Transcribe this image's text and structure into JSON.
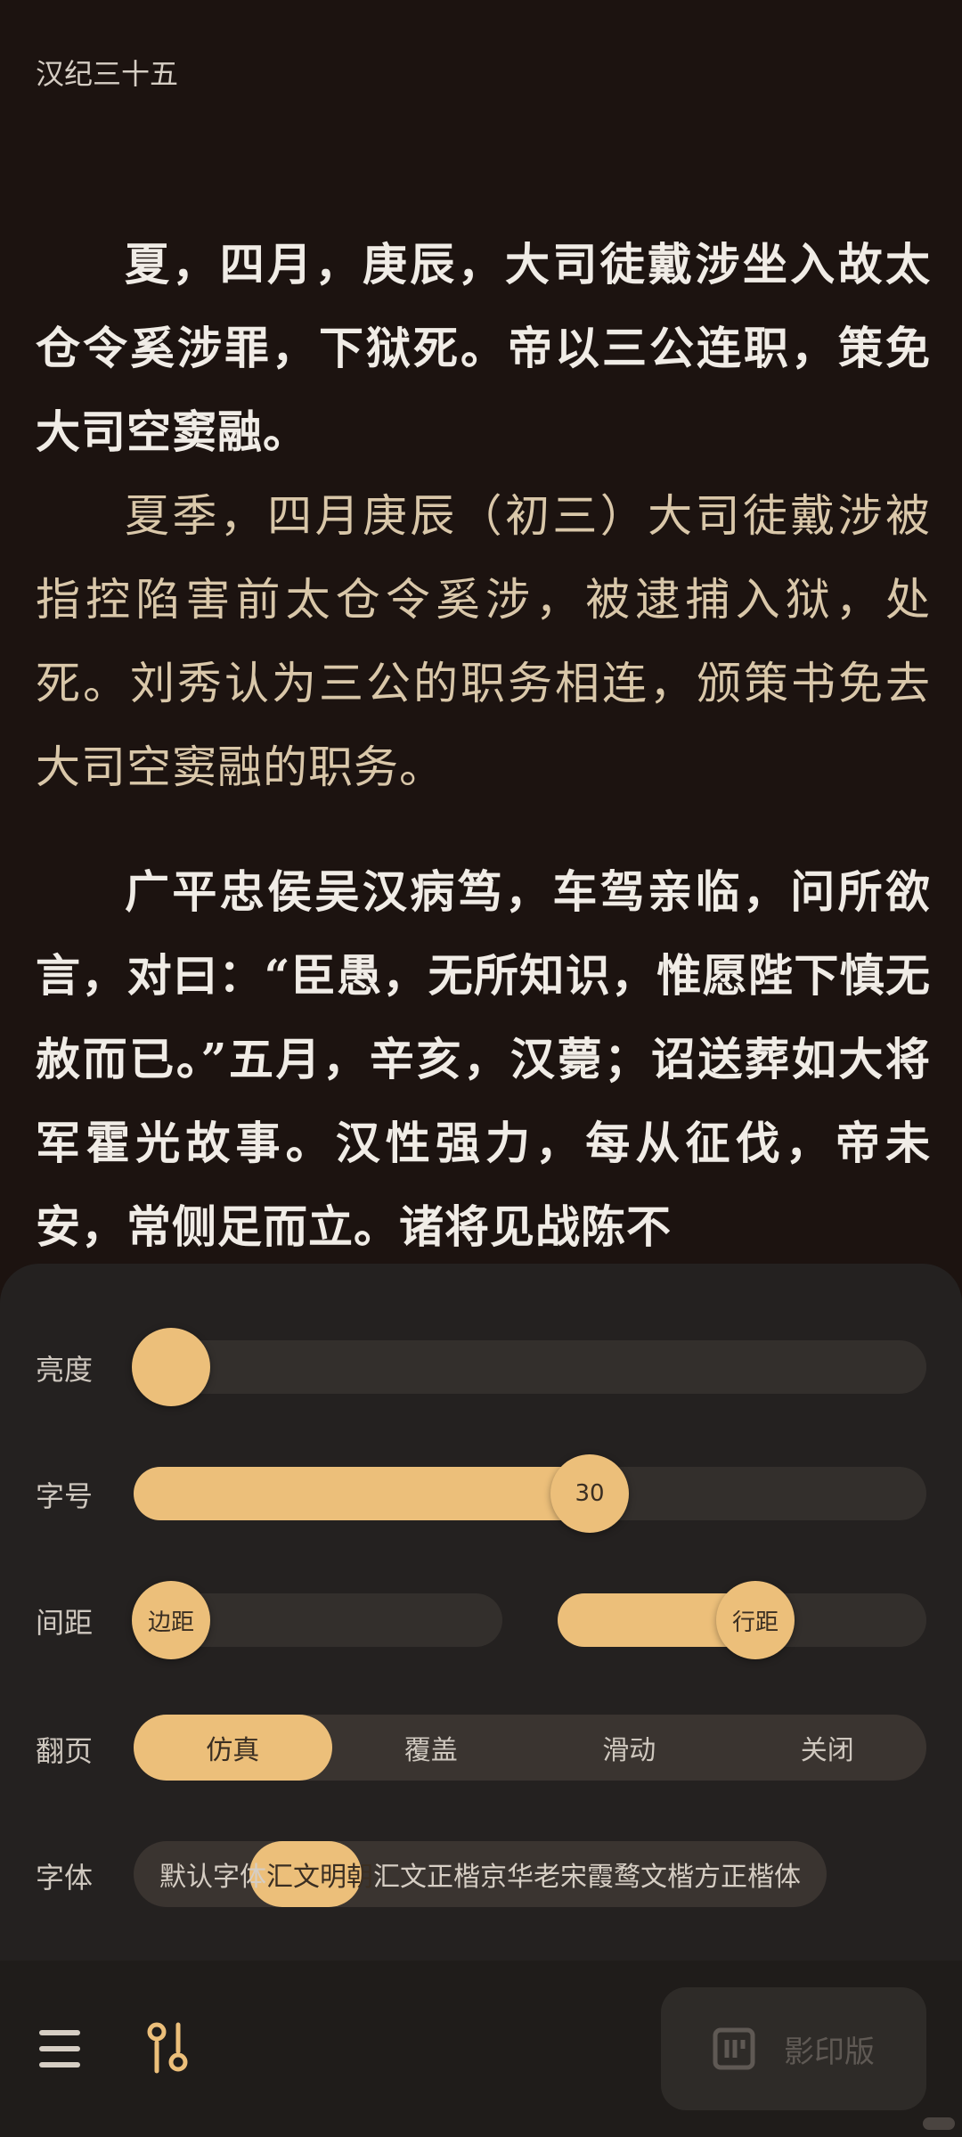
{
  "chapter_title": "汉纪三十五",
  "paragraphs": [
    {
      "type": "orig",
      "text": "夏，四月，庚辰，大司徒戴涉坐入故太仓令奚涉罪，下狱死。帝以三公连职，策免大司空窦融。"
    },
    {
      "type": "trans",
      "text": "夏季，四月庚辰（初三）大司徒戴涉被指控陷害前太仓令奚涉，被逮捕入狱，处死。刘秀认为三公的职务相连，颁策书免去大司空窦融的职务。"
    },
    {
      "type": "orig",
      "text": "广平忠侯吴汉病笃，车驾亲临，问所欲言，对曰：“臣愚，无所知识，惟愿陛下慎无赦而已。”五月，辛亥，汉薨；诏送葬如大将军霍光故事。汉性强力，每从征伐，帝未安，常侧足而立。诸将见战陈不"
    }
  ],
  "panel": {
    "brightness": {
      "label": "亮度",
      "value": 0.05
    },
    "font_size": {
      "label": "字号",
      "value": "30",
      "fraction": 0.57
    },
    "spacing": {
      "label": "间距",
      "left_knob": "边距",
      "left_value": 0.0,
      "right_knob": "行距",
      "right_value": 0.6
    },
    "page_turn": {
      "label": "翻页",
      "options": [
        "仿真",
        "覆盖",
        "滑动",
        "关闭"
      ],
      "selected": "仿真"
    },
    "font": {
      "label": "字体",
      "options": [
        "默认字体",
        "汇文明朝",
        "汇文正楷",
        "京华老宋",
        "霞鹜文楷",
        "方正楷体"
      ],
      "selected": "汇文明朝"
    }
  },
  "bottom_bar": {
    "print_label": "影印版",
    "icons": [
      "menu-icon",
      "settings-sliders-icon",
      "book-scan-icon"
    ]
  },
  "colors": {
    "accent": "#ecbf7a",
    "background": "#1c1310",
    "panel": "#242120"
  }
}
